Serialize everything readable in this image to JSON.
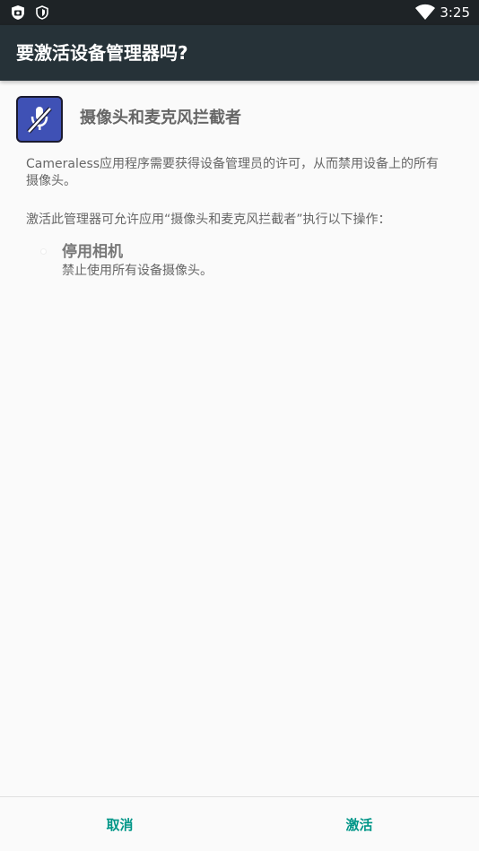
{
  "status_bar": {
    "time": "3:25",
    "left_icons": [
      "camera-shield-icon",
      "vpn-shield-icon"
    ],
    "right_icons": [
      "wifi-icon",
      "battery-icon"
    ]
  },
  "dialog": {
    "title": "要激活设备管理器吗?",
    "app_name": "摄像头和麦克风拦截者",
    "app_icon": "mic-off-icon",
    "description": "Cameraless应用程序需要获得设备管理员的许可，从而禁用设备上的所有摄像头。",
    "intro": "激活此管理器可允许应用“摄像头和麦克风拦截者”执行以下操作：",
    "policies": [
      {
        "title": "停用相机",
        "description": "禁止使用所有设备摄像头。"
      }
    ]
  },
  "buttons": {
    "cancel_label": "取消",
    "activate_label": "激活"
  },
  "colors": {
    "status_bar": "#1e2326",
    "title_bar": "#263238",
    "accent": "#009688",
    "app_icon_bg": "#3f51b5",
    "background": "#fafafa"
  }
}
